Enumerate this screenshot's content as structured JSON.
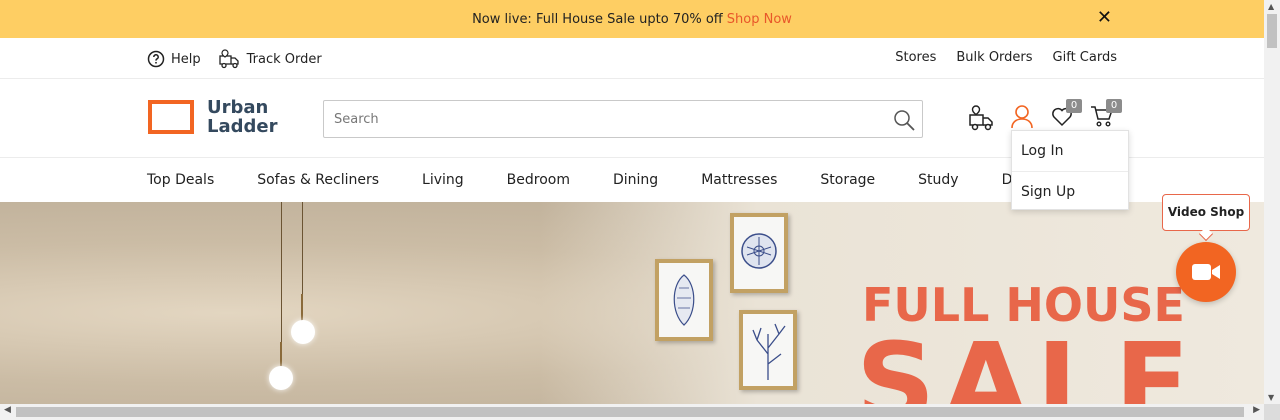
{
  "promo": {
    "text": "Now live: Full House Sale upto 70% off",
    "link": "Shop Now",
    "close_icon": "close-icon"
  },
  "utility": {
    "left": [
      {
        "label": "Help",
        "icon": "help-circle-icon"
      },
      {
        "label": "Track Order",
        "icon": "delivery-truck-icon"
      }
    ],
    "right": [
      "Stores",
      "Bulk Orders",
      "Gift Cards"
    ]
  },
  "header": {
    "logo_line1": "Urban",
    "logo_line2": "Ladder",
    "search_placeholder": "Search",
    "wishlist_count": "0",
    "cart_count": "0"
  },
  "nav": {
    "items": [
      "Top Deals",
      "Sofas & Recliners",
      "Living",
      "Bedroom",
      "Dining",
      "Mattresses",
      "Storage",
      "Study",
      "Decor"
    ]
  },
  "account_menu": {
    "items": [
      "Log In",
      "Sign Up"
    ]
  },
  "hero": {
    "title": "FULL HOUSE",
    "subtitle": "SALE"
  },
  "video_shop": {
    "label": "Video Shop",
    "icon": "video-camera-icon"
  },
  "colors": {
    "promo_bg": "#fece63",
    "accent": "#e8572a",
    "logo_orange": "#f26522",
    "logo_text": "#34495e",
    "hero_text": "#e8674a",
    "badge": "#8c8c8c"
  }
}
